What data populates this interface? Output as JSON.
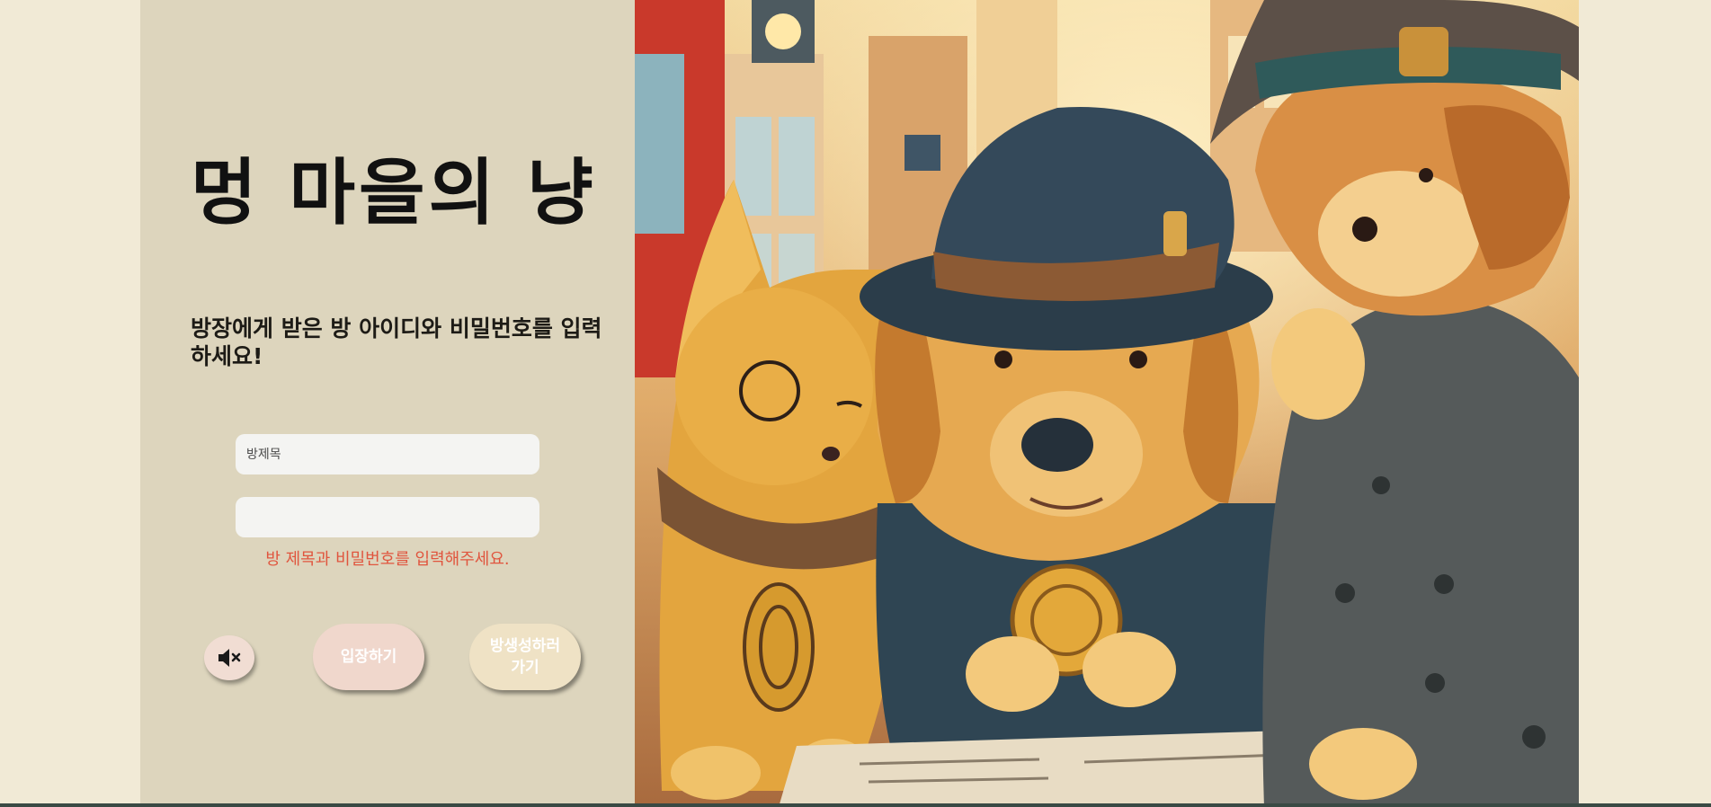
{
  "app": {
    "title": "멍 마을의 냥"
  },
  "login": {
    "instruction": "방장에게 받은 방 아이디와 비밀번호를 입력하세요!",
    "room_title_placeholder": "방제목",
    "room_password_placeholder": "",
    "error_message": "방 제목과 비밀번호를 입력해주세요.",
    "enter_label": "입장하기",
    "create_label": "방생성하러가기",
    "mute_icon": "speaker-mute-icon"
  },
  "illustration": {
    "description_icon": "detective-cat-and-dogs-illustration"
  },
  "colors": {
    "page_bg": "#f1ead6",
    "panel_bg": "#ddd5bd",
    "error": "#e0553e",
    "enter_button": "#f0d7cc",
    "create_button": "#efe2c5"
  }
}
